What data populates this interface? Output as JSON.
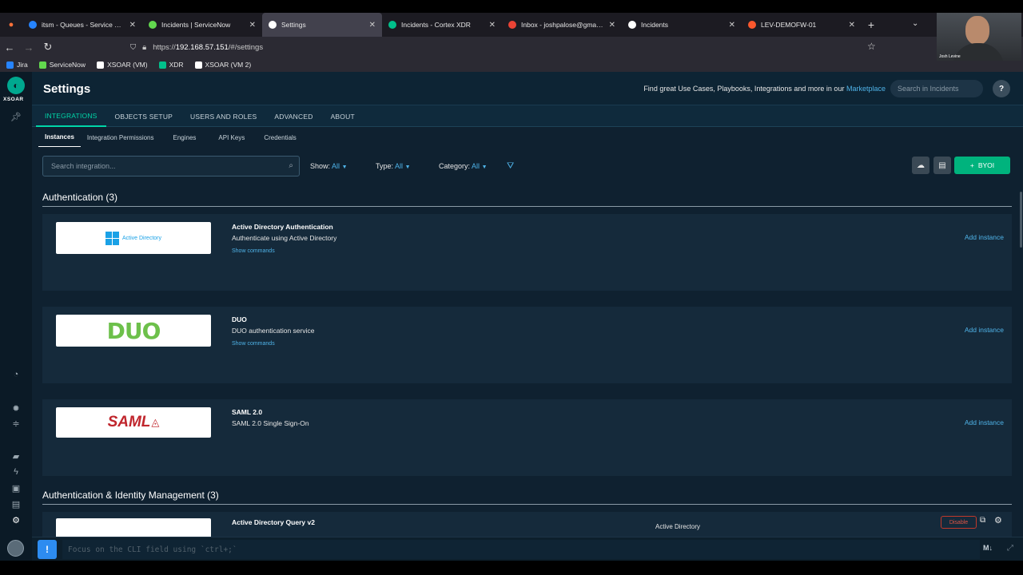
{
  "browser": {
    "tabs": [
      {
        "label": "itsm - Queues - Service project",
        "color": "#2684ff",
        "active": false
      },
      {
        "label": "Incidents | ServiceNow",
        "color": "#62d84e",
        "active": false
      },
      {
        "label": "Settings",
        "color": "#ffffff",
        "active": true
      },
      {
        "label": "Incidents - Cortex XDR",
        "color": "#00c08b",
        "active": false
      },
      {
        "label": "Inbox - joshpalose@gmail.com",
        "color": "#ea4335",
        "active": false
      },
      {
        "label": "Incidents",
        "color": "#ffffff",
        "active": false
      },
      {
        "label": "LEV-DEMOFW-01",
        "color": "#fa582d",
        "active": false
      }
    ],
    "url_prefix": "https://",
    "url_host": "192.168.57.151",
    "url_path": "/#/settings",
    "bookmarks": [
      {
        "label": "Jira",
        "color": "#2684ff"
      },
      {
        "label": "ServiceNow",
        "color": "#62d84e"
      },
      {
        "label": "XSOAR (VM)",
        "color": "#ffffff"
      },
      {
        "label": "XDR",
        "color": "#00c08b"
      },
      {
        "label": "XSOAR (VM 2)",
        "color": "#ffffff"
      }
    ],
    "webcam_name": "Josh Levine"
  },
  "app": {
    "logo_text": "XSOAR",
    "page_title": "Settings",
    "marketplace_text": "Find great Use Cases, Playbooks, Integrations and more in our",
    "marketplace_link": "Marketplace",
    "search_placeholder": "Search in Incidents",
    "help": "?",
    "main_tabs": [
      "INTEGRATIONS",
      "OBJECTS SETUP",
      "USERS AND ROLES",
      "ADVANCED",
      "ABOUT"
    ],
    "sub_tabs": [
      "Instances",
      "Integration Permissions",
      "Engines",
      "API Keys",
      "Credentials"
    ],
    "integration_search_placeholder": "Search integration...",
    "filters": {
      "show_label": "Show:",
      "show_value": "All",
      "type_label": "Type:",
      "type_value": "All",
      "category_label": "Category:",
      "category_value": "All"
    },
    "byoi_label": "BYOI",
    "sections": [
      {
        "title": "Authentication (3)"
      },
      {
        "title": "Authentication & Identity Management (3)"
      }
    ],
    "cards": [
      {
        "name": "Active Directory Authentication",
        "description": "Authenticate using Active Directory",
        "commands": "Show commands",
        "action": "Add instance",
        "logo_text": "Active Directory"
      },
      {
        "name": "DUO",
        "description": "DUO authentication service",
        "commands": "Show commands",
        "action": "Add instance",
        "logo_text": "DUO"
      },
      {
        "name": "SAML 2.0",
        "description": "SAML 2.0 Single Sign-On",
        "commands": "",
        "action": "Add instance",
        "logo_text": "SAML"
      },
      {
        "name": "Active Directory Query v2",
        "extra": "Active Directory",
        "disable": "Disable"
      }
    ],
    "cli_placeholder": "Focus on the CLI field using `ctrl+;`",
    "cli_md": "M↓"
  }
}
